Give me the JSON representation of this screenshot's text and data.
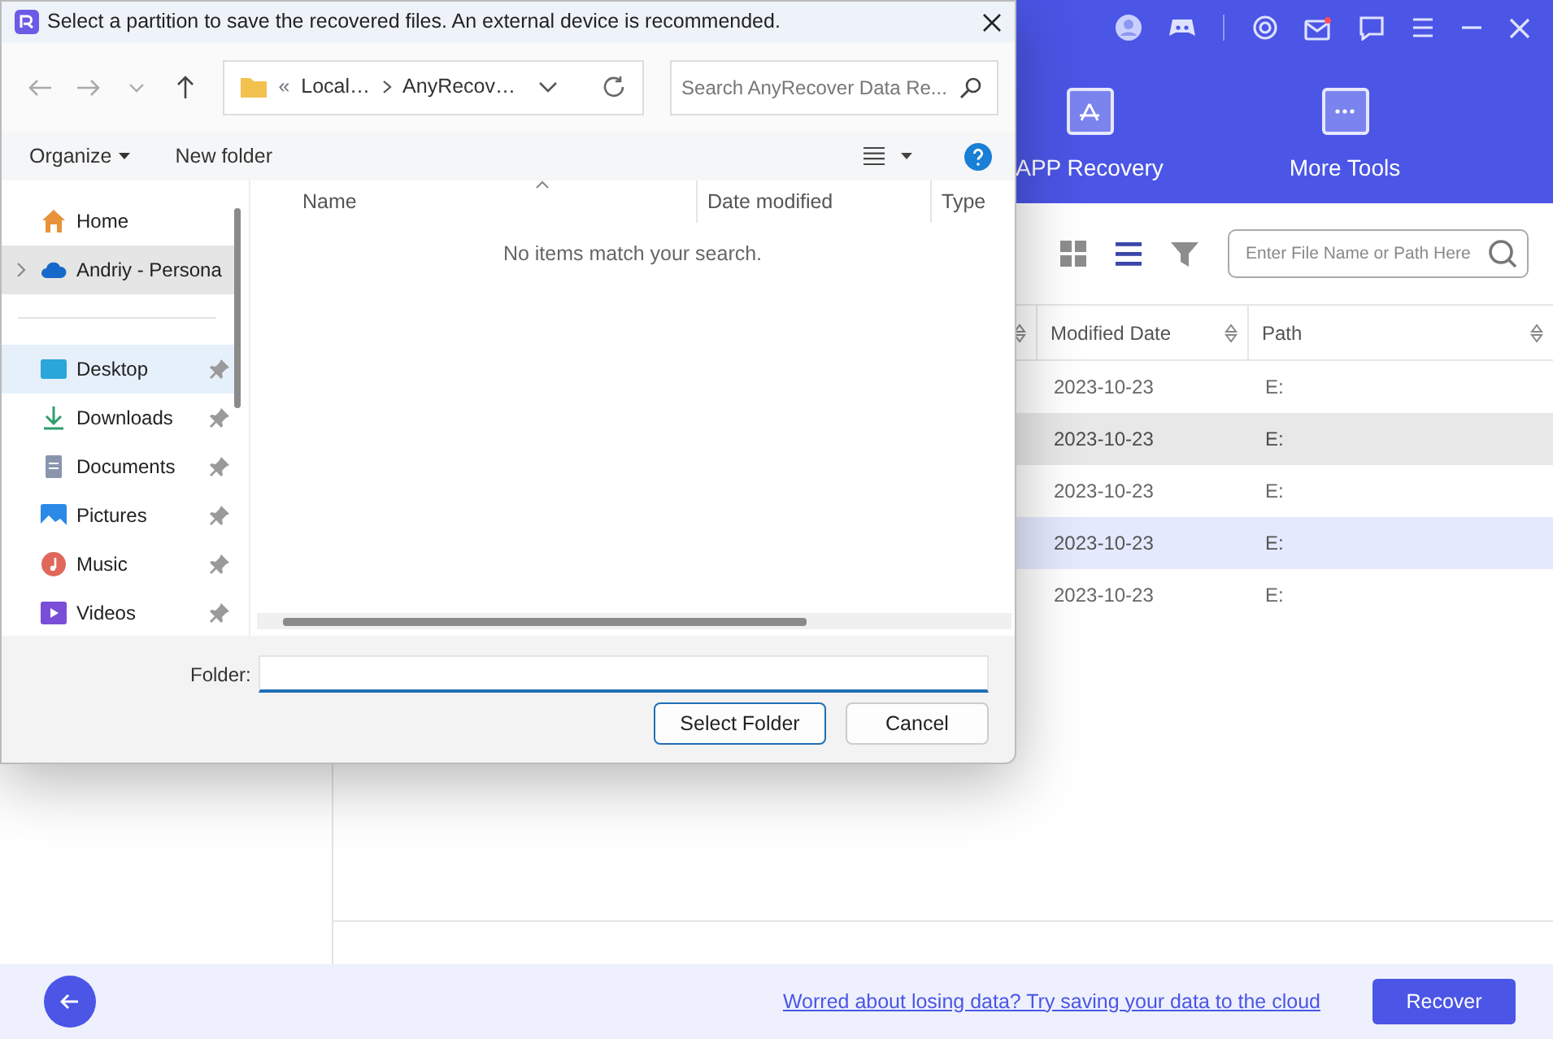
{
  "app": {
    "header_tabs": [
      {
        "label": "APP Recovery",
        "kind": "app",
        "selected": false
      },
      {
        "label": "More Tools",
        "kind": "more",
        "selected": false
      }
    ],
    "mail_unread": true,
    "view_modes": [
      {
        "kind": "grid",
        "selected": false
      },
      {
        "kind": "list",
        "selected": true
      }
    ],
    "search": {
      "placeholder": "Enter File Name or Path Here"
    },
    "table": {
      "columns": [
        {
          "label": "Modified Date"
        },
        {
          "label": "Path"
        }
      ],
      "rows": [
        {
          "modified": "2023-10-23",
          "path": "E:",
          "selected": false,
          "hovered": false
        },
        {
          "modified": "2023-10-23",
          "path": "E:",
          "selected": false,
          "hovered": true
        },
        {
          "modified": "2023-10-23",
          "path": "E:",
          "selected": false,
          "hovered": false
        },
        {
          "modified": "2023-10-23",
          "path": "E:",
          "selected": true,
          "hovered": false
        },
        {
          "modified": "2023-10-23",
          "path": "E:",
          "selected": false,
          "hovered": false
        }
      ]
    },
    "footer": {
      "cloud_link": "Worred about losing data? Try saving your data to the cloud",
      "recover_button": "Recover"
    }
  },
  "dialog": {
    "title": "Select a partition to save the recovered files. An external device is recommended.",
    "breadcrumb_prefix": "«",
    "breadcrumb": [
      "Local…",
      "AnyRecov…"
    ],
    "search": {
      "placeholder": "Search AnyRecover Data Re..."
    },
    "commands": {
      "organize": "Organize",
      "new_folder": "New folder"
    },
    "nav_sections": [
      {
        "items": [
          {
            "label": "Home",
            "kind": "home",
            "selected": false,
            "hovered": false,
            "pinned": false,
            "expandable": false
          },
          {
            "label": "Andriy - Persona",
            "kind": "cloud",
            "selected": true,
            "hovered": false,
            "pinned": false,
            "expandable": true
          }
        ]
      },
      {
        "items": [
          {
            "label": "Desktop",
            "kind": "desktop",
            "selected": false,
            "hovered": true,
            "pinned": true,
            "expandable": false
          },
          {
            "label": "Downloads",
            "kind": "downloads",
            "selected": false,
            "hovered": false,
            "pinned": true,
            "expandable": false
          },
          {
            "label": "Documents",
            "kind": "documents",
            "selected": false,
            "hovered": false,
            "pinned": true,
            "expandable": false
          },
          {
            "label": "Pictures",
            "kind": "pictures",
            "selected": false,
            "hovered": false,
            "pinned": true,
            "expandable": false
          },
          {
            "label": "Music",
            "kind": "music",
            "selected": false,
            "hovered": false,
            "pinned": true,
            "expandable": false
          },
          {
            "label": "Videos",
            "kind": "videos",
            "selected": false,
            "hovered": false,
            "pinned": true,
            "expandable": false
          }
        ]
      }
    ],
    "columns": [
      "Name",
      "Date modified",
      "Type"
    ],
    "empty_message": "No items match your search.",
    "folder_label": "Folder:",
    "buttons": [
      {
        "label": "Select Folder",
        "default": true
      },
      {
        "label": "Cancel",
        "default": false
      }
    ]
  }
}
